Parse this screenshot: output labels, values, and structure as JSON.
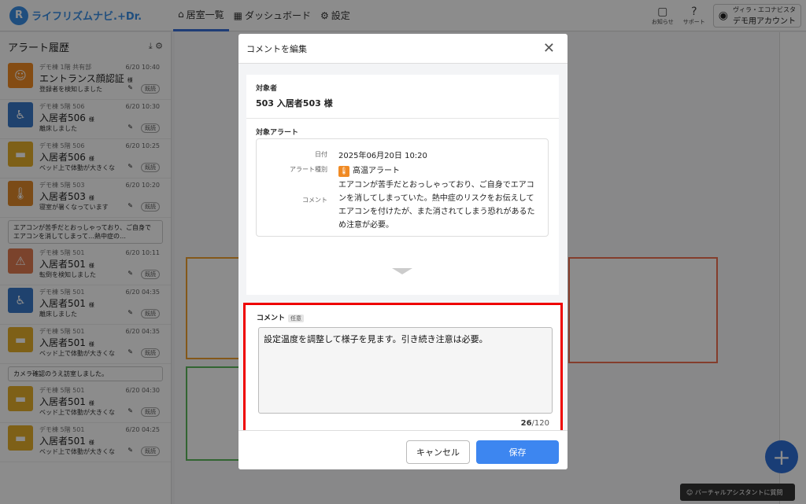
{
  "app": {
    "logo_mark": "R",
    "logo_text": "ライフリズムナビ.+Dr."
  },
  "nav": [
    {
      "icon": "⌂",
      "label": "居室一覧"
    },
    {
      "icon": "▦",
      "label": "ダッシュボード"
    },
    {
      "icon": "⚙",
      "label": "設定"
    }
  ],
  "topright": {
    "notice": "お知らせ",
    "support": "サポート",
    "account_line1": "ヴィラ・エコナビスタ",
    "account_line2": "デモ用アカウント"
  },
  "sidebar": {
    "title": "アラート履歴",
    "alerts": [
      {
        "loc": "デモ棟 1階 共有部",
        "name": "エントランス顔認証",
        "suffix": "様",
        "desc": "登録者を検知しました",
        "time": "6/20 10:40",
        "color": "#f08a24",
        "icon": "☺"
      },
      {
        "loc": "デモ棟 5階 506",
        "name": "入居者506",
        "suffix": "様",
        "desc": "離床しました",
        "time": "6/20 10:30",
        "color": "#3a78c8",
        "icon": "♿"
      },
      {
        "loc": "デモ棟 5階 506",
        "name": "入居者506",
        "suffix": "様",
        "desc": "ベッド上で体動が大きくな",
        "time": "6/20 10:25",
        "color": "#e6b02a",
        "icon": "▬"
      },
      {
        "loc": "デモ棟 5階 503",
        "name": "入居者503",
        "suffix": "様",
        "desc": "寝室が暑くなっています",
        "time": "6/20 10:20",
        "color": "#e0892a",
        "icon": "🌡"
      },
      {
        "loc": "デモ棟 5階 501",
        "name": "入居者501",
        "suffix": "様",
        "desc": "転倒を検知しました",
        "time": "6/20 10:11",
        "color": "#e07a50",
        "icon": "⚠"
      },
      {
        "loc": "デモ棟 5階 501",
        "name": "入居者501",
        "suffix": "様",
        "desc": "離床しました",
        "time": "6/20 04:35",
        "color": "#3a78c8",
        "icon": "♿"
      },
      {
        "loc": "デモ棟 5階 501",
        "name": "入居者501",
        "suffix": "様",
        "desc": "ベッド上で体動が大きくな",
        "time": "6/20 04:35",
        "color": "#e6b02a",
        "icon": "▬"
      },
      {
        "loc": "デモ棟 5階 501",
        "name": "入居者501",
        "suffix": "様",
        "desc": "ベッド上で体動が大きくな",
        "time": "6/20 04:30",
        "color": "#e6b02a",
        "icon": "▬"
      },
      {
        "loc": "デモ棟 5階 501",
        "name": "入居者501",
        "suffix": "様",
        "desc": "ベッド上で体動が大きくな",
        "time": "6/20 04:25",
        "color": "#e6b02a",
        "icon": "▬"
      }
    ],
    "comment1": "エアコンが苦手だとおっしゃっており、ご自身でエアコンを消してしまって…熱中症の…",
    "comment2": "カメラ確認のうえ訪室しました。",
    "read_btn": "既読"
  },
  "assistant": "バーチャルアシスタントに質問",
  "modal": {
    "title": "コメントを編集",
    "target_label": "対象者",
    "target_value": "503 入居者503 様",
    "alert_label": "対象アラート",
    "date_key": "日付",
    "date_val": "2025年06月20日 10:20",
    "type_key": "アラート種別",
    "type_val": "高温アラート",
    "comment_key": "コメント",
    "comment_val": "エアコンが苦手だとおっしゃっており、ご自身でエアコンを消してしまっていた。熱中症のリスクをお伝えしてエアコンを付けたが、また消されてしまう恐れがあるため注意が必要。",
    "comment_label": "コメント",
    "optional": "任意",
    "textarea": "設定温度を調整して様子を見ます。引き続き注意は必要。",
    "count_used": "26",
    "count_max": "/120",
    "cancel": "キャンセル",
    "save": "保存"
  }
}
